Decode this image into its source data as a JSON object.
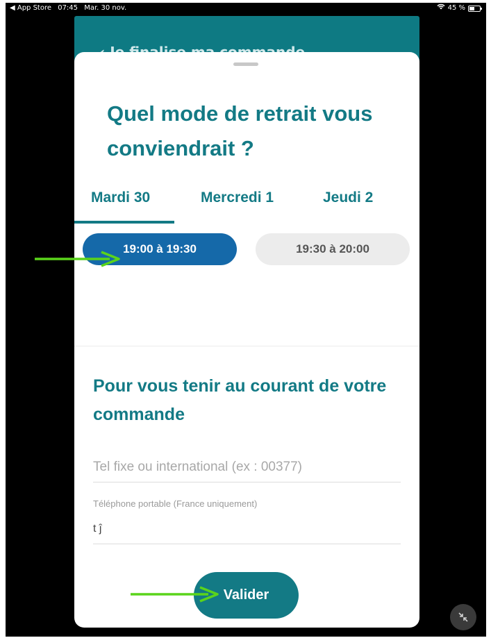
{
  "statusbar": {
    "back_app": "◀ App Store",
    "time": "07:45",
    "date": "Mar. 30 nov.",
    "wifi_icon": "wifi-icon",
    "battery_text": "45 %",
    "battery_level": 0.45
  },
  "header": {
    "title": "Je finalise ma commande"
  },
  "sheet": {
    "title": "Quel mode de retrait vous conviendrait ?",
    "tabs": [
      {
        "label": "Mardi 30",
        "selected": true
      },
      {
        "label": "Mercredi 1",
        "selected": false
      },
      {
        "label": "Jeudi 2",
        "selected": false
      }
    ],
    "slots": [
      {
        "label": "19:00 à 19:30",
        "selected": true
      },
      {
        "label": "19:30 à 20:00",
        "selected": false
      }
    ],
    "contact": {
      "title": "Pour vous tenir au courant de votre commande",
      "landline_placeholder": "Tel fixe ou international (ex : 00377)",
      "mobile_label": "Téléphone portable (France uniquement)",
      "mobile_value": "t                  ĵ"
    },
    "validate_label": "Valider"
  },
  "colors": {
    "accent": "#137a85",
    "selected_slot": "#1569a9",
    "annotation_arrow": "#5ad41b"
  }
}
